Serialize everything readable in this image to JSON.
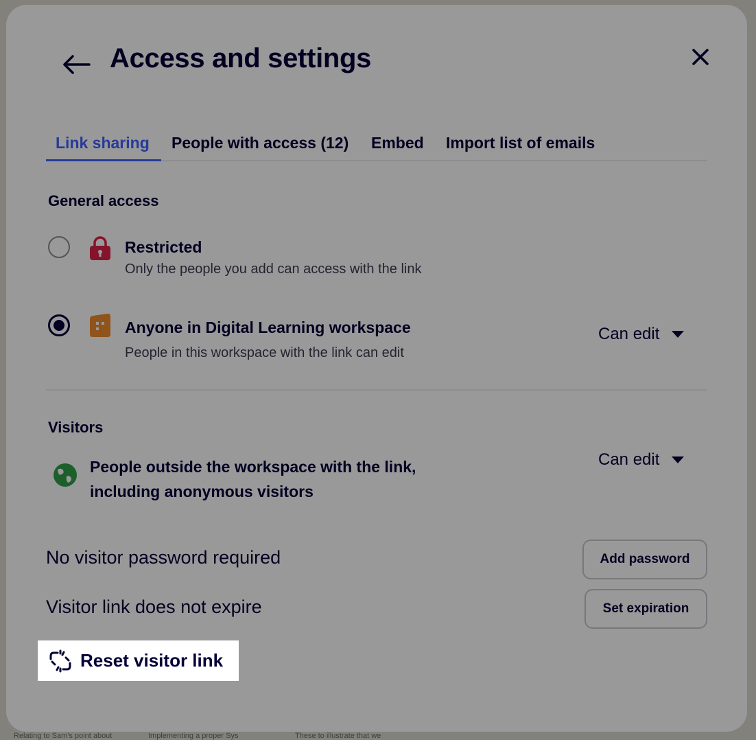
{
  "background_board": {
    "notes": [
      "Relating to Sam's point about",
      "Implementing a proper Sys",
      "These to illustrate that we"
    ]
  },
  "dialog": {
    "title": "Access and settings",
    "back_icon": "arrow-left-icon",
    "close_icon": "close-icon"
  },
  "tabs": [
    {
      "label": "Link sharing",
      "active": true
    },
    {
      "label": "People with access (12)",
      "active": false
    },
    {
      "label": "Embed",
      "active": false
    },
    {
      "label": "Import list of emails",
      "active": false
    }
  ],
  "general_access": {
    "heading": "General access",
    "options": [
      {
        "title": "Restricted",
        "subtitle": "Only the people you add can access with the link",
        "icon": "lock-icon",
        "selected": false
      },
      {
        "title": "Anyone in Digital Learning workspace",
        "subtitle": "People in this workspace with the link can edit",
        "icon": "workspace-icon",
        "selected": true,
        "permission": "Can edit"
      }
    ]
  },
  "visitors": {
    "heading": "Visitors",
    "description": "People outside the workspace with the link, including anonymous visitors",
    "icon": "globe-icon",
    "permission": "Can edit"
  },
  "password": {
    "status": "No visitor password required",
    "button": "Add password"
  },
  "expiration": {
    "status": "Visitor link does not expire",
    "button": "Set expiration"
  },
  "reset_link": {
    "label": "Reset visitor link",
    "icon": "broken-link-icon"
  },
  "colors": {
    "accent": "#4262ff",
    "text": "#050038",
    "lock": "#e0204a",
    "workspace": "#f08a2e",
    "globe": "#2f9e48"
  }
}
